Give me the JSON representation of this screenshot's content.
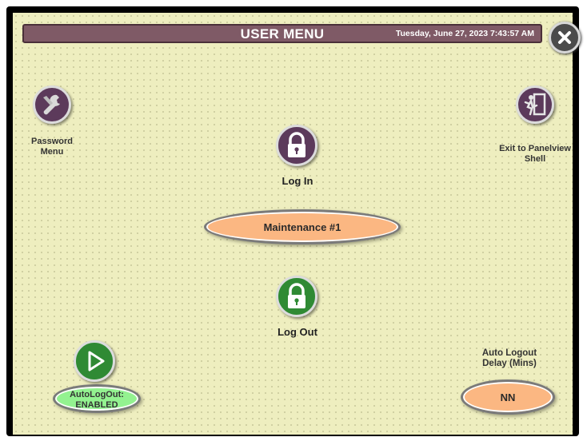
{
  "header": {
    "title": "USER MENU",
    "datetime": "Tuesday, June 27, 2023 7:43:57 AM"
  },
  "buttons": {
    "password_menu": {
      "label_line1": "Password",
      "label_line2": "Menu",
      "icon": "wrench-icon"
    },
    "exit_panelview": {
      "label_line1": "Exit to Panelview",
      "label_line2": "Shell",
      "icon": "exit-door-icon"
    },
    "log_in": {
      "label": "Log In",
      "icon": "padlock-locked-icon"
    },
    "log_out": {
      "label": "Log Out",
      "icon": "padlock-unlocked-icon"
    },
    "auto_logout_toggle": {
      "icon": "toggle-play-icon"
    },
    "close": {
      "icon": "close-icon"
    }
  },
  "current_user": "Maintenance #1",
  "auto_logout": {
    "status_line1": "AutoLogOut:",
    "status_line2": "ENABLED",
    "delay_label_line1": "Auto Logout",
    "delay_label_line2": "Delay (Mins)",
    "delay_value": "NN"
  },
  "colors": {
    "background": "#eeeebf",
    "titlebar": "#7f5a66",
    "purple_button": "#5c3a5b",
    "green_button": "#2f8a34",
    "orange_field": "#fbb782",
    "green_field": "#93f290"
  }
}
